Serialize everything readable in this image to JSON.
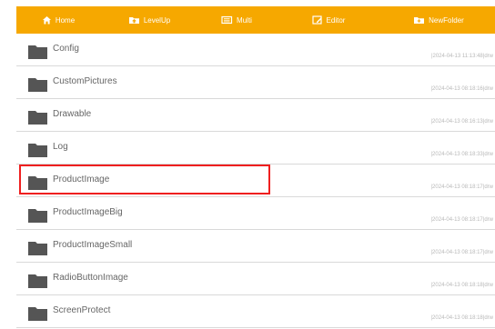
{
  "toolbar": {
    "home": {
      "label": "Home",
      "icon": "home-icon"
    },
    "levelup": {
      "label": "LevelUp",
      "icon": "level-up-icon"
    },
    "multi": {
      "label": "Multi",
      "icon": "multi-select-icon"
    },
    "editor": {
      "label": "Editor",
      "icon": "editor-icon"
    },
    "newfolder": {
      "label": "NewFolder",
      "icon": "new-folder-icon"
    }
  },
  "list": {
    "items": [
      {
        "name": "Config",
        "meta": "|2024-04-13 11:13:48|drw"
      },
      {
        "name": "CustomPictures",
        "meta": "|2024-04-13 08:18:16|drw"
      },
      {
        "name": "Drawable",
        "meta": "|2024-04-13 08:16:13|drw"
      },
      {
        "name": "Log",
        "meta": "|2024-04-13 08:18:33|drw"
      },
      {
        "name": "ProductImage",
        "meta": "|2024-04-13 08:18:17|drw"
      },
      {
        "name": "ProductImageBig",
        "meta": "|2024-04-13 08:18:17|drw"
      },
      {
        "name": "ProductImageSmall",
        "meta": "|2024-04-13 08:18:17|drw"
      },
      {
        "name": "RadioButtonImage",
        "meta": "|2024-04-13 08:18:18|drw"
      },
      {
        "name": "ScreenProtect",
        "meta": "|2024-04-13 08:18:18|drw"
      }
    ],
    "selected_item": "ProductImage"
  },
  "colors": {
    "toolbar": "#f6a800",
    "toolbar_text": "#ffffff",
    "folder_icon": "#555555",
    "item_text": "#666666",
    "meta_text": "#b8b8b8",
    "divider": "#d9d9d9",
    "selection_outline": "#ef1f1f"
  }
}
